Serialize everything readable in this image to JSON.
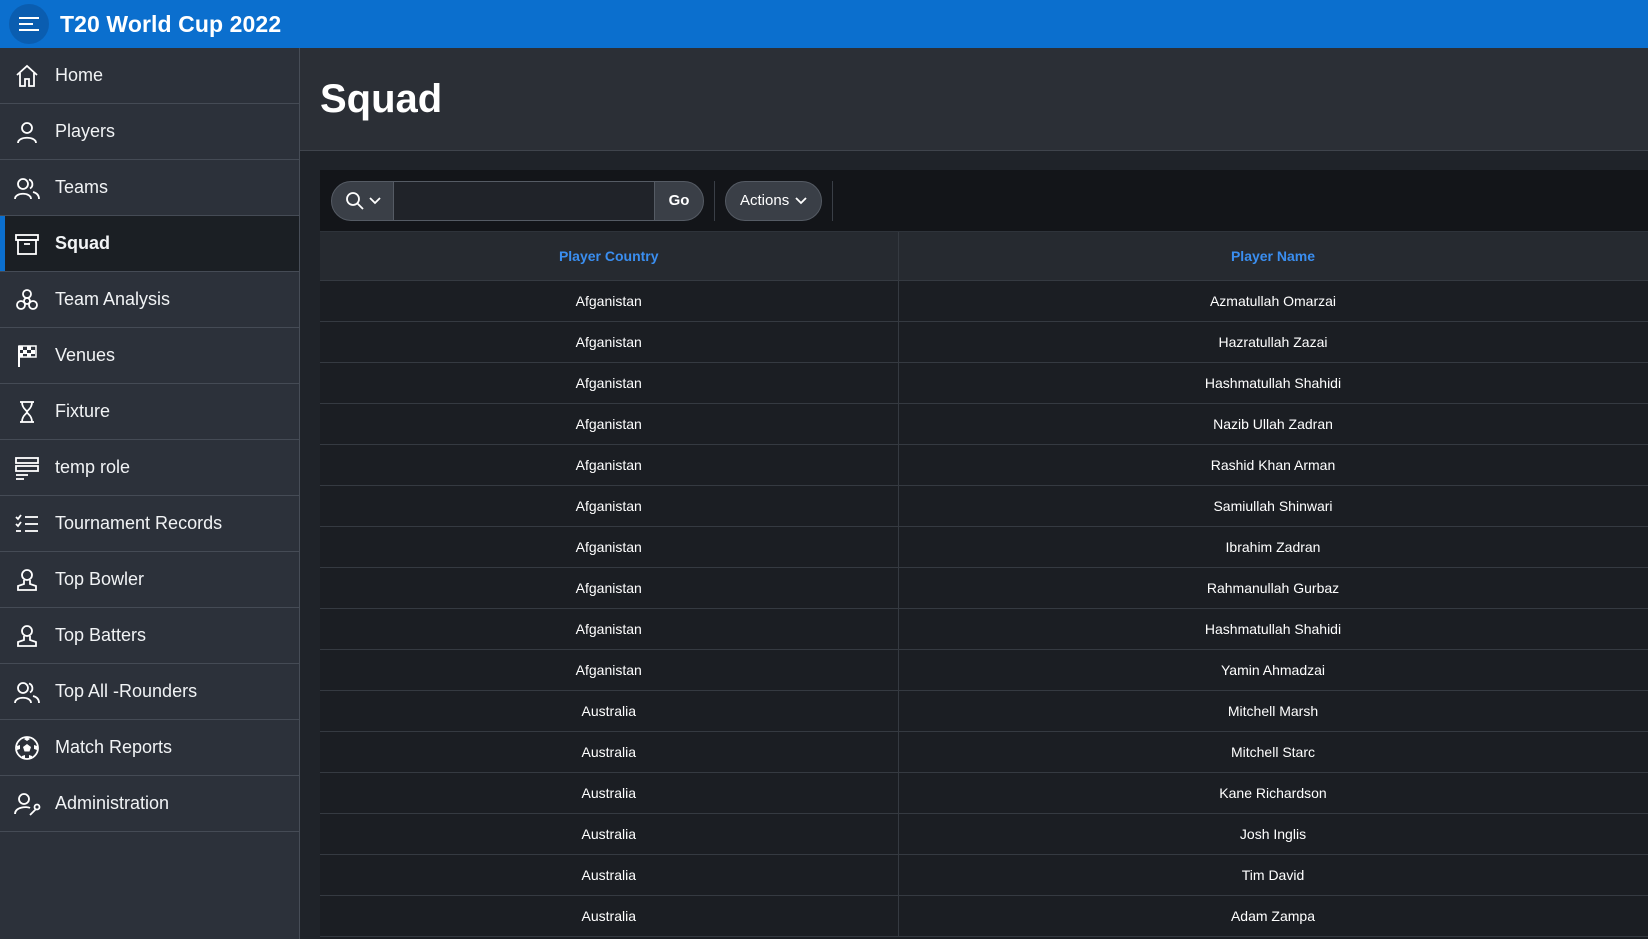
{
  "app": {
    "title": "T20 World Cup 2022",
    "accent_color": "#0b6fce"
  },
  "sidebar": {
    "items": [
      {
        "label": "Home",
        "icon": "home-icon",
        "active": false
      },
      {
        "label": "Players",
        "icon": "user-icon",
        "active": false
      },
      {
        "label": "Teams",
        "icon": "users-icon",
        "active": false
      },
      {
        "label": "Squad",
        "icon": "archive-box-icon",
        "active": true
      },
      {
        "label": "Team Analysis",
        "icon": "biohazard-icon",
        "active": false
      },
      {
        "label": "Venues",
        "icon": "checkered-flag-icon",
        "active": false
      },
      {
        "label": "Fixture",
        "icon": "hourglass-icon",
        "active": false
      },
      {
        "label": "temp role",
        "icon": "server-list-icon",
        "active": false
      },
      {
        "label": "Tournament Records",
        "icon": "checklist-icon",
        "active": false
      },
      {
        "label": "Top Bowler",
        "icon": "user-outline-icon",
        "active": false
      },
      {
        "label": "Top Batters",
        "icon": "user-outline-icon",
        "active": false
      },
      {
        "label": "Top All -Rounders",
        "icon": "users-icon",
        "active": false
      },
      {
        "label": "Match Reports",
        "icon": "soccer-ball-icon",
        "active": false
      },
      {
        "label": "Administration",
        "icon": "user-wrench-icon",
        "active": false
      }
    ]
  },
  "page": {
    "title": "Squad"
  },
  "toolbar": {
    "search_value": "",
    "go_label": "Go",
    "actions_label": "Actions"
  },
  "table": {
    "columns": [
      "Player Country",
      "Player Name"
    ],
    "rows": [
      [
        "Afganistan",
        "Azmatullah Omarzai"
      ],
      [
        "Afganistan",
        "Hazratullah Zazai"
      ],
      [
        "Afganistan",
        "Hashmatullah Shahidi"
      ],
      [
        "Afganistan",
        "Nazib Ullah Zadran"
      ],
      [
        "Afganistan",
        "Rashid Khan Arman"
      ],
      [
        "Afganistan",
        "Samiullah Shinwari"
      ],
      [
        "Afganistan",
        "Ibrahim Zadran"
      ],
      [
        "Afganistan",
        "Rahmanullah Gurbaz"
      ],
      [
        "Afganistan",
        "Hashmatullah Shahidi"
      ],
      [
        "Afganistan",
        "Yamin Ahmadzai"
      ],
      [
        "Australia",
        "Mitchell Marsh"
      ],
      [
        "Australia",
        "Mitchell Starc"
      ],
      [
        "Australia",
        "Kane Richardson"
      ],
      [
        "Australia",
        "Josh Inglis"
      ],
      [
        "Australia",
        "Tim David"
      ],
      [
        "Australia",
        "Adam Zampa"
      ]
    ]
  }
}
